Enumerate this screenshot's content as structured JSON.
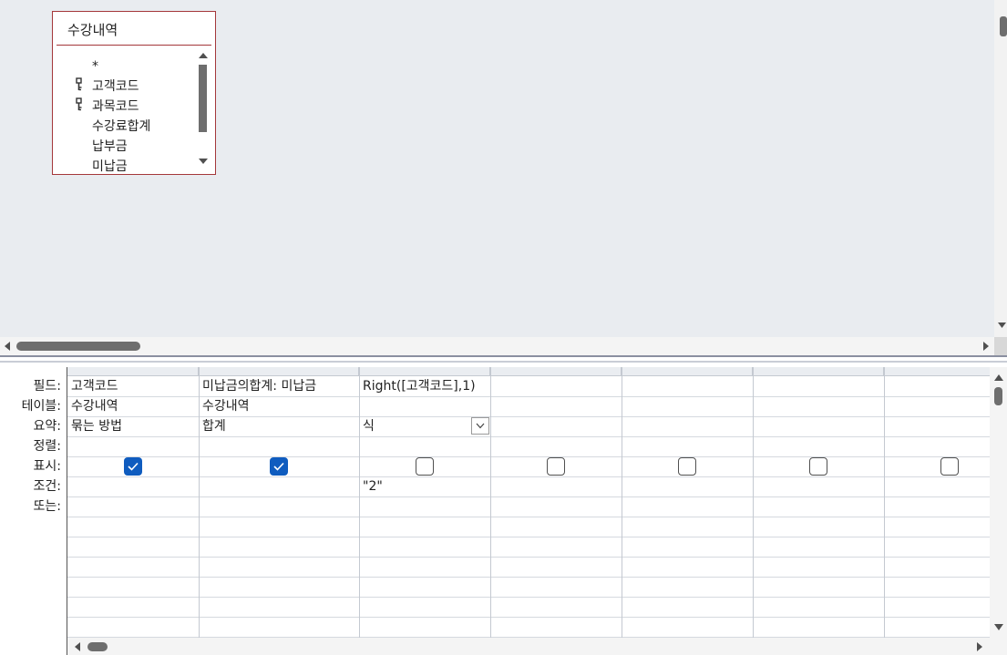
{
  "table_box": {
    "title": "수강내역",
    "fields": [
      {
        "label": "*",
        "key": false
      },
      {
        "label": "고객코드",
        "key": true
      },
      {
        "label": "과목코드",
        "key": true
      },
      {
        "label": "수강료합계",
        "key": false
      },
      {
        "label": "납부금",
        "key": false
      },
      {
        "label": "미납금",
        "key": false
      }
    ]
  },
  "grid": {
    "row_labels": {
      "field": "필드:",
      "table": "테이블:",
      "total": "요약:",
      "sort": "정렬:",
      "show": "표시:",
      "criteria": "조건:",
      "or": "또는:"
    },
    "columns": [
      {
        "field": "고객코드",
        "table": "수강내역",
        "total": "묶는 방법",
        "show": true,
        "criteria": ""
      },
      {
        "field": "미납금의합계: 미납금",
        "table": "수강내역",
        "total": "합계",
        "show": true,
        "criteria": ""
      },
      {
        "field": "Right([고객코드],1)",
        "table": "",
        "total": "식",
        "show": false,
        "criteria": "\"2\""
      },
      {
        "field": "",
        "table": "",
        "total": "",
        "show": false,
        "criteria": ""
      },
      {
        "field": "",
        "table": "",
        "total": "",
        "show": false,
        "criteria": ""
      },
      {
        "field": "",
        "table": "",
        "total": "",
        "show": false,
        "criteria": ""
      },
      {
        "field": "",
        "table": "",
        "total": "",
        "show": false,
        "criteria": ""
      }
    ]
  },
  "colors": {
    "checkbox_checked": "#0f5cbf",
    "table_border": "#a4373a",
    "design_background": "#e9ecf0"
  }
}
